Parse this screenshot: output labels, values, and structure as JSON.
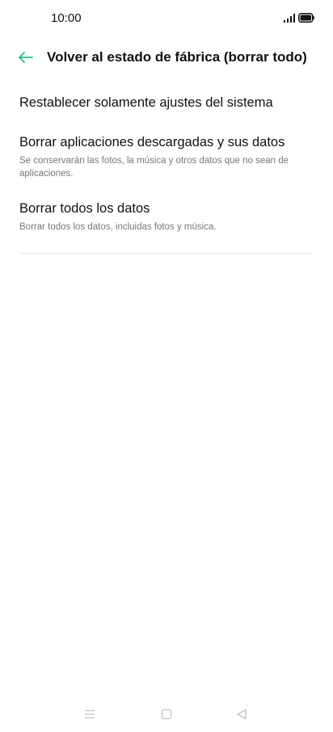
{
  "status_bar": {
    "time": "10:00"
  },
  "header": {
    "title": "Volver al estado de fábrica (borrar todo)",
    "back_icon": "arrow-left-icon",
    "accent_color": "#2fb98f"
  },
  "options": [
    {
      "title": "Restablecer solamente ajustes del sistema",
      "description": ""
    },
    {
      "title": "Borrar aplicaciones descargadas y sus datos",
      "description": "Se conservarán las fotos, la música y otros datos que no sean de aplicaciones."
    },
    {
      "title": "Borrar todos los datos",
      "description": "Borrar todos los datos, incluidas fotos y música."
    }
  ],
  "nav_bar": {
    "menu_icon": "menu-icon",
    "home_icon": "home-icon",
    "back_icon": "back-triangle-icon"
  }
}
